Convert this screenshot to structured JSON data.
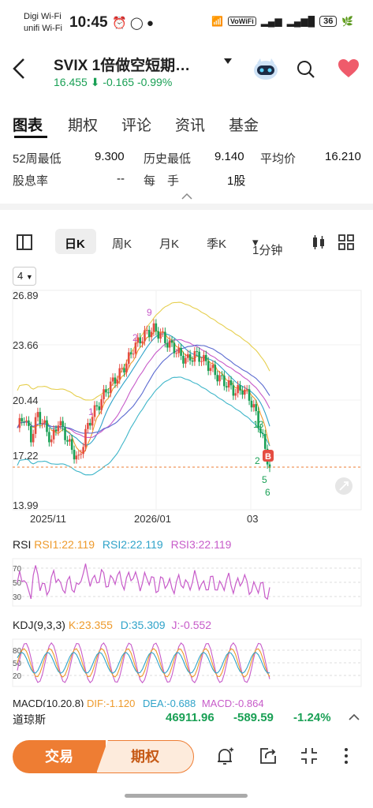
{
  "status": {
    "carrier1": "Digi Wi-Fi",
    "carrier2": "unifi Wi-Fi",
    "time": "10:45",
    "wifi_badge": "VoWiFi",
    "battery": "36"
  },
  "header": {
    "title": "SVIX  1倍做空短期…",
    "price": "16.455",
    "change": "-0.165",
    "change_pct": "-0.99%",
    "price_color": "#1aa055"
  },
  "tabs": [
    "图表",
    "期权",
    "评论",
    "资讯",
    "基金"
  ],
  "stats": {
    "low52_label": "52周最低",
    "low52_value": "9.300",
    "hist_low_label": "历史最低",
    "hist_low_value": "9.140",
    "avg_label": "平均价",
    "avg_value": "16.210",
    "div_label": "股息率",
    "div_value": "--",
    "lot_label": "每　手",
    "lot_value": "1股"
  },
  "toolbar": {
    "day_k": "日K",
    "week_k": "周K",
    "month_k": "月K",
    "quarter_k": "季K",
    "minute": "1分钟"
  },
  "period_select": "4",
  "chart": {
    "y_labels": [
      "26.89",
      "23.66",
      "20.44",
      "17.22",
      "13.99"
    ],
    "x_labels": [
      "2025/11",
      "2026/01",
      "03"
    ],
    "markers": {
      "b": "B",
      "n5": "5",
      "n6": "6",
      "n2": "2",
      "n13": "13",
      "n9": "9",
      "n1": "1",
      "n2b": "2"
    },
    "up_color": "#e54d42",
    "down_color": "#1aa055"
  },
  "rsi": {
    "title": "RSI",
    "rsi1": "RSI1:22.119",
    "rsi2": "RSI2:22.119",
    "rsi3": "RSI3:22.119",
    "levels": [
      "70",
      "50",
      "30"
    ]
  },
  "kdj": {
    "title": "KDJ(9,3,3)",
    "k": "K:23.355",
    "d": "D:35.309",
    "j": "J:-0.552",
    "levels": [
      "80",
      "50",
      "20"
    ]
  },
  "macd": {
    "title": "MACD(10,20,8)",
    "dif": "DIF:-1.120",
    "dea": "DEA:-0.688",
    "macd": "MACD:-0.864"
  },
  "ticker": {
    "name": "道琼斯",
    "price": "46911.96",
    "change": "-589.59",
    "change_pct": "-1.24%"
  },
  "bottom": {
    "trade": "交易",
    "option": "期权"
  },
  "chart_data": {
    "type": "line",
    "title": "",
    "y_ticks": [
      26.89,
      23.66,
      20.44,
      17.22,
      13.99
    ],
    "ylim": [
      13.99,
      26.89
    ],
    "x_ticks": [
      "2025/11",
      "2026/01",
      "03"
    ],
    "series": [
      {
        "values": [
          18.8,
          19.5,
          18.2,
          19.6,
          18.9,
          18.0,
          19.2,
          18.4,
          17.5,
          16.9,
          18.5,
          19.6,
          20.2,
          21.0,
          21.5,
          22.0,
          22.6,
          23.5,
          24.0,
          24.4,
          24.6,
          24.3,
          23.8,
          23.5,
          23.0,
          22.8,
          23.1,
          22.9,
          22.5,
          22.0,
          21.6,
          21.3,
          20.9,
          21.1,
          20.6,
          19.6,
          18.1,
          16.455
        ]
      }
    ]
  }
}
